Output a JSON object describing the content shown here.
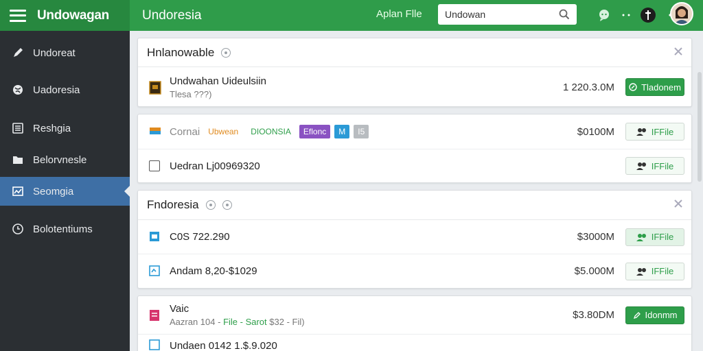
{
  "brand": {
    "name": "Undowagan"
  },
  "app_title": "Undoresia",
  "top_link": "Aplan Flle",
  "search": {
    "value": "Undowan",
    "placeholder": ""
  },
  "sidebar": {
    "items": [
      {
        "label": "Undoreat",
        "icon": "pen-icon"
      },
      {
        "label": "Uadoresia",
        "icon": "globe-icon"
      },
      {
        "label": "Reshgia",
        "icon": "list-icon"
      },
      {
        "label": "Belorvnesle",
        "icon": "folder-icon"
      },
      {
        "label": "Seomgia",
        "icon": "chart-icon",
        "active": true
      },
      {
        "label": "Bolotentiums",
        "icon": "clock-icon"
      }
    ]
  },
  "card1": {
    "title": "Hnlanowable",
    "row": {
      "name": "Undwahan Uideulsiin",
      "sub": "Tlesa ???)",
      "amount": "1 220.3.0M",
      "button": "Tladonem"
    }
  },
  "card2": {
    "row1": {
      "name": "Cornai",
      "tags": [
        {
          "text": "Ubwean",
          "color": "#e08a1e",
          "bg": "transparent"
        },
        {
          "text": "DIOONSIA",
          "color": "#2e9e4a",
          "bg": "transparent"
        },
        {
          "text": "Eflonc",
          "color": "#ffffff",
          "bg": "#8a52c2"
        },
        {
          "text": "M",
          "color": "#ffffff",
          "bg": "#2b9ad6"
        },
        {
          "text": "I5",
          "color": "#ffffff",
          "bg": "#b8bcc0"
        }
      ],
      "amount": "$0100M",
      "button": "IFFile"
    },
    "row2": {
      "name": "Uedran Lj00969320",
      "button": "IFFile"
    }
  },
  "card3": {
    "title": "Fndoresia",
    "row1": {
      "name": "C0S 722.290",
      "amount": "$3000M",
      "button": "IFFile"
    },
    "row2": {
      "name": "Andam 8,20-$1029",
      "amount": "$5.000M",
      "button": "IFFile"
    }
  },
  "card4": {
    "row1": {
      "name": "Vaic",
      "sub_prefix": "Aazran 104 -",
      "sub_file": "File",
      "sub_mid": "- Sarot",
      "sub_suffix": "$32 - Fil)",
      "amount": "$3.80DM",
      "button": "Idonmm"
    },
    "row2": {
      "name": "Undaen 0142 1.$.9.020"
    }
  },
  "colors": {
    "brand_green": "#2f9c4a",
    "sidebar": "#2b2f33",
    "active": "#3e6fa5"
  }
}
